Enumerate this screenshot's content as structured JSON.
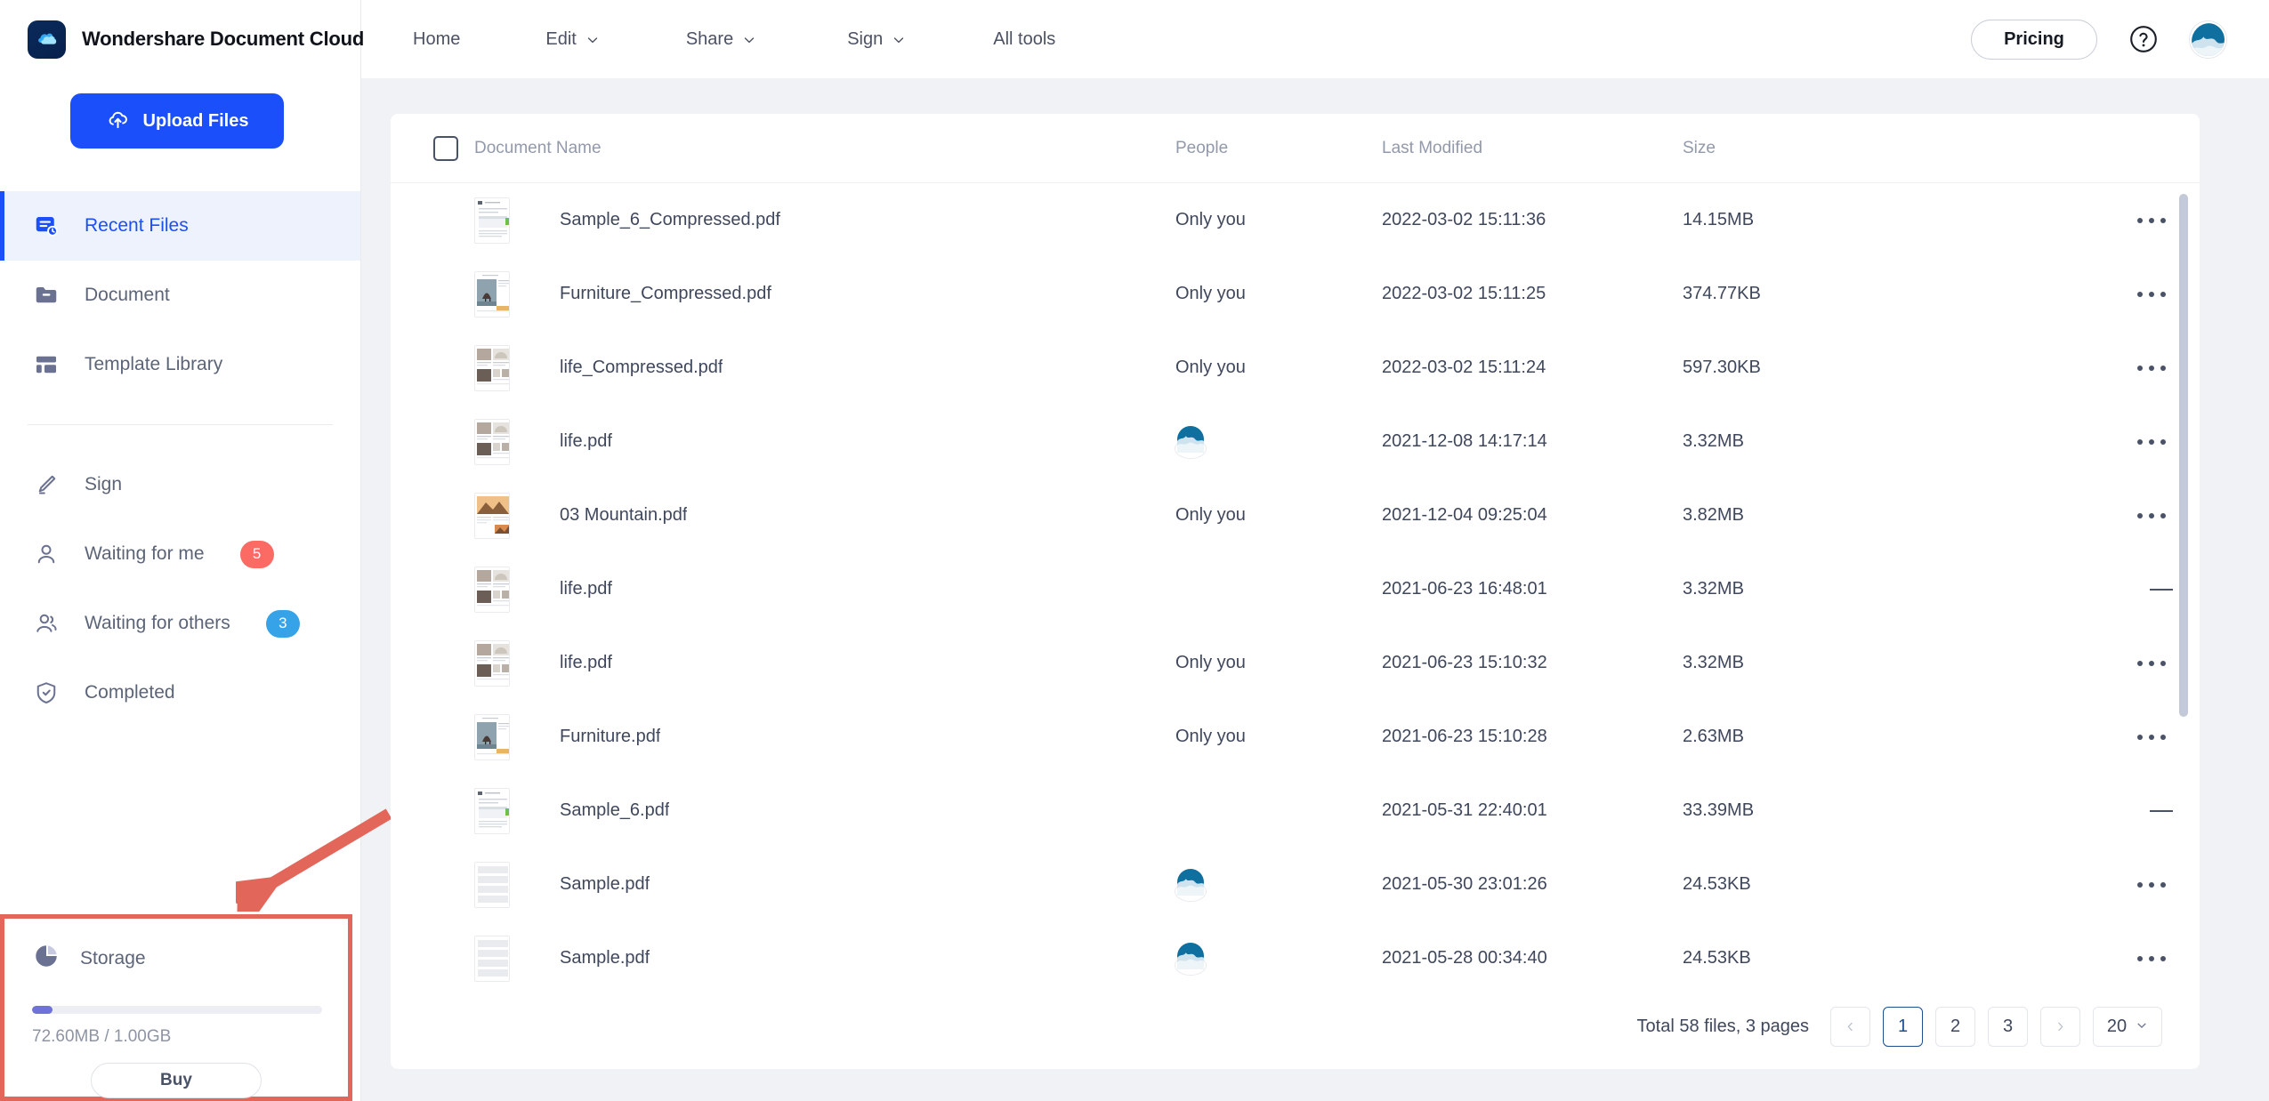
{
  "brand": {
    "name": "Wondershare Document Cloud",
    "logo_icon": "cloud-logo-icon"
  },
  "sidebar": {
    "upload_button": {
      "label": "Upload Files",
      "icon": "cloud-upload-icon"
    },
    "items": [
      {
        "label": "Recent Files",
        "icon": "recent-files-icon",
        "active": true
      },
      {
        "label": "Document",
        "icon": "folder-icon",
        "active": false
      },
      {
        "label": "Template Library",
        "icon": "template-library-icon",
        "active": false
      }
    ],
    "items2": [
      {
        "label": "Sign",
        "icon": "pen-icon",
        "badge": null,
        "badge_color": null
      },
      {
        "label": "Waiting for me",
        "icon": "user-icon",
        "badge": "5",
        "badge_color": "#fb6a63"
      },
      {
        "label": "Waiting for others",
        "icon": "users-icon",
        "badge": "3",
        "badge_color": "#36a3e8"
      },
      {
        "label": "Completed",
        "icon": "shield-check-icon",
        "badge": null,
        "badge_color": null
      }
    ],
    "storage": {
      "title": "Storage",
      "icon": "pie-chart-icon",
      "usage": "72.60MB / 1.00GB",
      "percent": 7.2,
      "buy_label": "Buy",
      "highlight_color": "#e2675a"
    }
  },
  "topbar": {
    "nav": [
      {
        "label": "Home",
        "has_caret": false
      },
      {
        "label": "Edit",
        "has_caret": true
      },
      {
        "label": "Share",
        "has_caret": true
      },
      {
        "label": "Sign",
        "has_caret": true
      },
      {
        "label": "All tools",
        "has_caret": false
      }
    ],
    "pricing_label": "Pricing",
    "help_icon": "question-circle-icon",
    "avatar": "user-avatar"
  },
  "table": {
    "columns": [
      "Document Name",
      "People",
      "Last Modified",
      "Size"
    ],
    "rows": [
      {
        "name": "Sample_6_Compressed.pdf",
        "people": "Only you",
        "people_type": "text",
        "modified": "2022-03-02 15:11:36",
        "size": "14.15MB",
        "action": "more",
        "thumb": "doc"
      },
      {
        "name": "Furniture_Compressed.pdf",
        "people": "Only you",
        "people_type": "text",
        "modified": "2022-03-02 15:11:25",
        "size": "374.77KB",
        "action": "more",
        "thumb": "furniture"
      },
      {
        "name": "life_Compressed.pdf",
        "people": "Only you",
        "people_type": "text",
        "modified": "2022-03-02 15:11:24",
        "size": "597.30KB",
        "action": "more",
        "thumb": "magazine"
      },
      {
        "name": "life.pdf",
        "people": "",
        "people_type": "avatar",
        "modified": "2021-12-08 14:17:14",
        "size": "3.32MB",
        "action": "more",
        "thumb": "magazine"
      },
      {
        "name": "03 Mountain.pdf",
        "people": "Only you",
        "people_type": "text",
        "modified": "2021-12-04 09:25:04",
        "size": "3.82MB",
        "action": "more",
        "thumb": "mountain"
      },
      {
        "name": "life.pdf",
        "people": "",
        "people_type": "none",
        "modified": "2021-06-23 16:48:01",
        "size": "3.32MB",
        "action": "dash",
        "thumb": "magazine"
      },
      {
        "name": "life.pdf",
        "people": "Only you",
        "people_type": "text",
        "modified": "2021-06-23 15:10:32",
        "size": "3.32MB",
        "action": "more",
        "thumb": "magazine"
      },
      {
        "name": "Furniture.pdf",
        "people": "Only you",
        "people_type": "text",
        "modified": "2021-06-23 15:10:28",
        "size": "2.63MB",
        "action": "more",
        "thumb": "furniture"
      },
      {
        "name": "Sample_6.pdf",
        "people": "",
        "people_type": "none",
        "modified": "2021-05-31 22:40:01",
        "size": "33.39MB",
        "action": "dash",
        "thumb": "doc"
      },
      {
        "name": "Sample.pdf",
        "people": "",
        "people_type": "avatar",
        "modified": "2021-05-30 23:01:26",
        "size": "24.53KB",
        "action": "more",
        "thumb": "plain"
      },
      {
        "name": "Sample.pdf",
        "people": "",
        "people_type": "avatar",
        "modified": "2021-05-28 00:34:40",
        "size": "24.53KB",
        "action": "more",
        "thumb": "plain"
      }
    ]
  },
  "pagination": {
    "total_label": "Total 58 files, 3 pages",
    "prev_icon": "chevron-left-icon",
    "next_icon": "chevron-right-icon",
    "pages": [
      "1",
      "2",
      "3"
    ],
    "current_page": "1",
    "page_size": "20",
    "page_size_caret": "chevron-down-icon"
  }
}
